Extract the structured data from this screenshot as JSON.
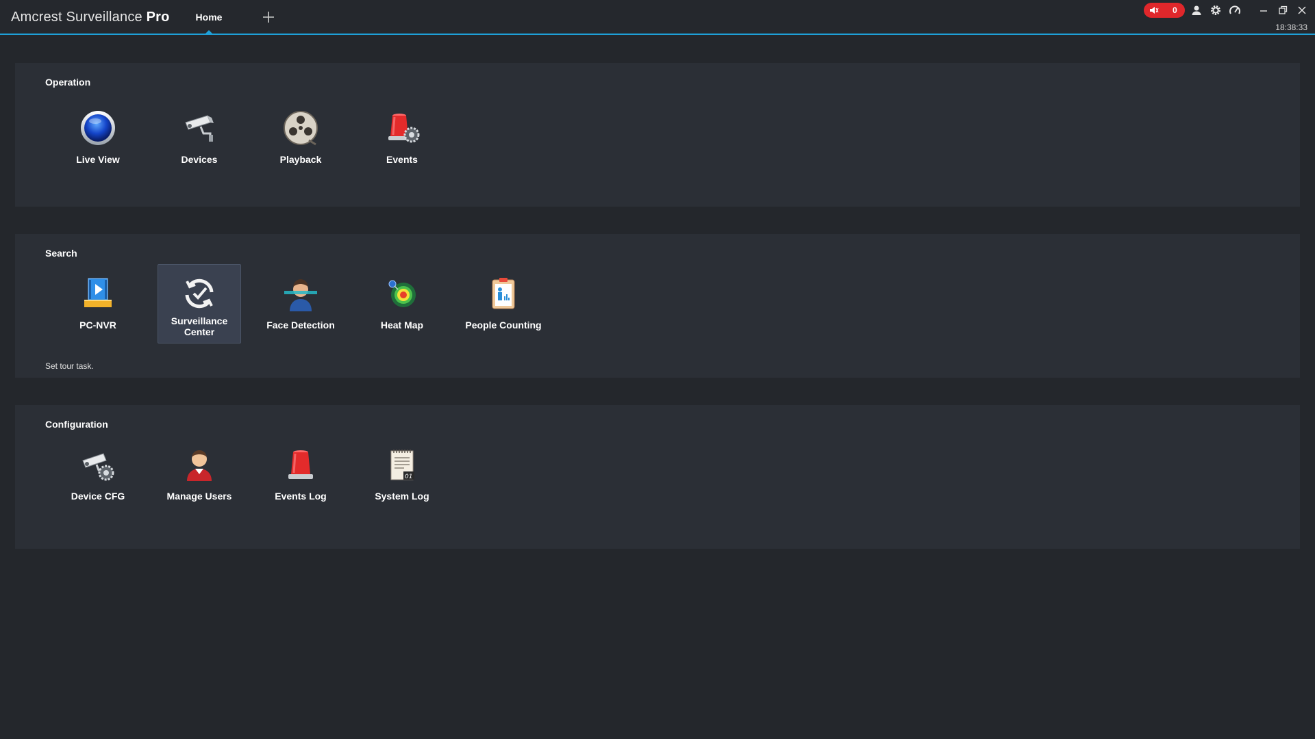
{
  "window": {
    "title_prefix": "Amcrest Surveillance ",
    "title_bold": "Pro",
    "tab_home": "Home",
    "alarm_count": "0",
    "clock": "18:38:33"
  },
  "colors": {
    "accent": "#1ea0d8",
    "alarm": "#e0272b",
    "panel": "#2b2f36",
    "background": "#24272c"
  },
  "operation": {
    "title": "Operation",
    "items": [
      {
        "label": "Live View",
        "icon": "live-view-icon"
      },
      {
        "label": "Devices",
        "icon": "camera-icon"
      },
      {
        "label": "Playback",
        "icon": "film-reel-icon"
      },
      {
        "label": "Events",
        "icon": "alarm-siren-gear-icon"
      }
    ]
  },
  "search": {
    "title": "Search",
    "items": [
      {
        "label": "PC-NVR",
        "icon": "pc-nvr-icon"
      },
      {
        "label": "Surveillance Center",
        "icon": "sync-check-icon",
        "selected": true
      },
      {
        "label": "Face Detection",
        "icon": "face-scan-icon"
      },
      {
        "label": "Heat Map",
        "icon": "heat-map-icon"
      },
      {
        "label": "People Counting",
        "icon": "people-counting-icon"
      }
    ],
    "tip": "Set tour task."
  },
  "configuration": {
    "title": "Configuration",
    "items": [
      {
        "label": "Device CFG",
        "icon": "camera-gear-icon"
      },
      {
        "label": "Manage Users",
        "icon": "user-icon"
      },
      {
        "label": "Events Log",
        "icon": "alarm-siren-icon"
      },
      {
        "label": "System Log",
        "icon": "notepad-icon"
      }
    ]
  }
}
